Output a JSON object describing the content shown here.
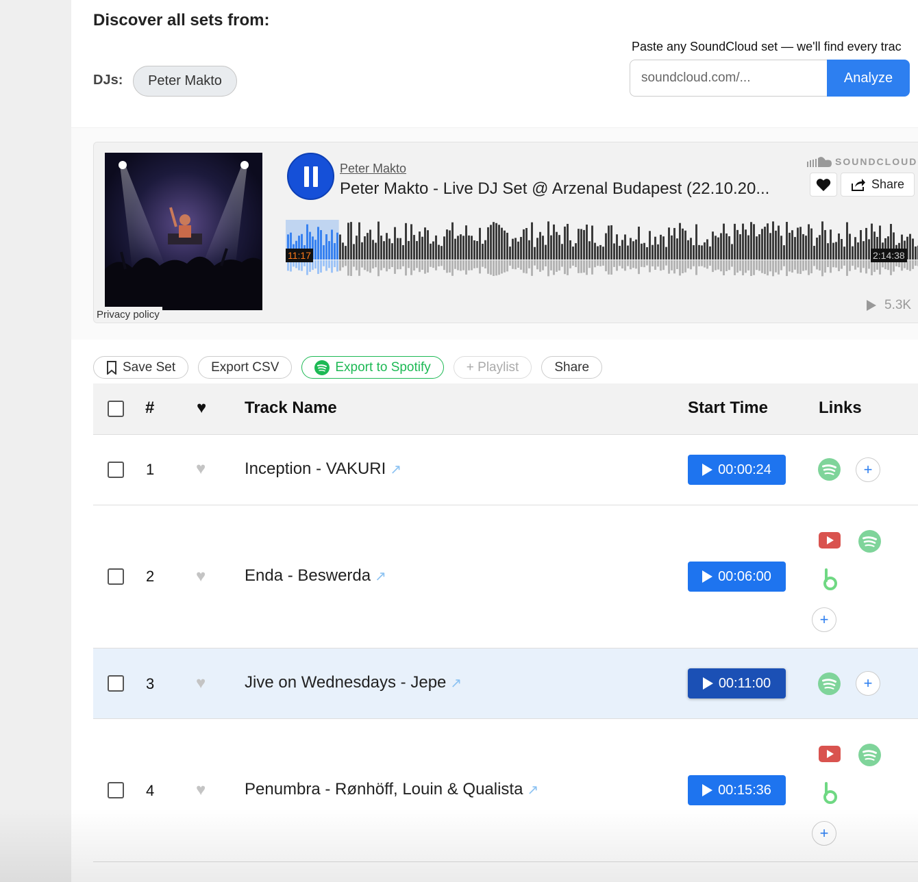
{
  "header": {
    "title": "Discover all sets from:",
    "djs_label": "DJs:",
    "dj_chip": "Peter Makto"
  },
  "analyze": {
    "hint": "Paste any SoundCloud set — we'll find every trac",
    "placeholder": "soundcloud.com/...",
    "button": "Analyze"
  },
  "player": {
    "uploader": "Peter Makto",
    "title": "Peter Makto - Live DJ Set @ Arzenal Budapest (22.10.20...",
    "brand": "SOUNDCLOUD",
    "share_label": "Share",
    "current_time": "11:17",
    "total_time": "2:14:38",
    "plays": "5.3K",
    "privacy": "Privacy policy",
    "progress_fraction": 0.084
  },
  "actions": {
    "save": "Save Set",
    "export_csv": "Export CSV",
    "export_spotify": "Export to Spotify",
    "playlist": "+ Playlist",
    "share": "Share"
  },
  "table": {
    "headers": {
      "num": "#",
      "heart": "♥",
      "track": "Track Name",
      "start": "Start Time",
      "links": "Links"
    },
    "rows": [
      {
        "num": "1",
        "track": "Inception - VAKURI",
        "start": "00:00:24"
      },
      {
        "num": "2",
        "track": "Enda - Beswerda",
        "start": "00:06:00"
      },
      {
        "num": "3",
        "track": "Jive on Wednesdays - Jepe",
        "start": "00:11:00"
      },
      {
        "num": "4",
        "track": "Penumbra - Rønhöff, Louin & Qualista",
        "start": "00:15:36"
      }
    ]
  },
  "colors": {
    "accent": "#1e74ef",
    "spotify": "#1db954",
    "youtube": "#d9534f",
    "beatport": "#7fdc8d",
    "highlight_row": "#e8f1fb"
  }
}
